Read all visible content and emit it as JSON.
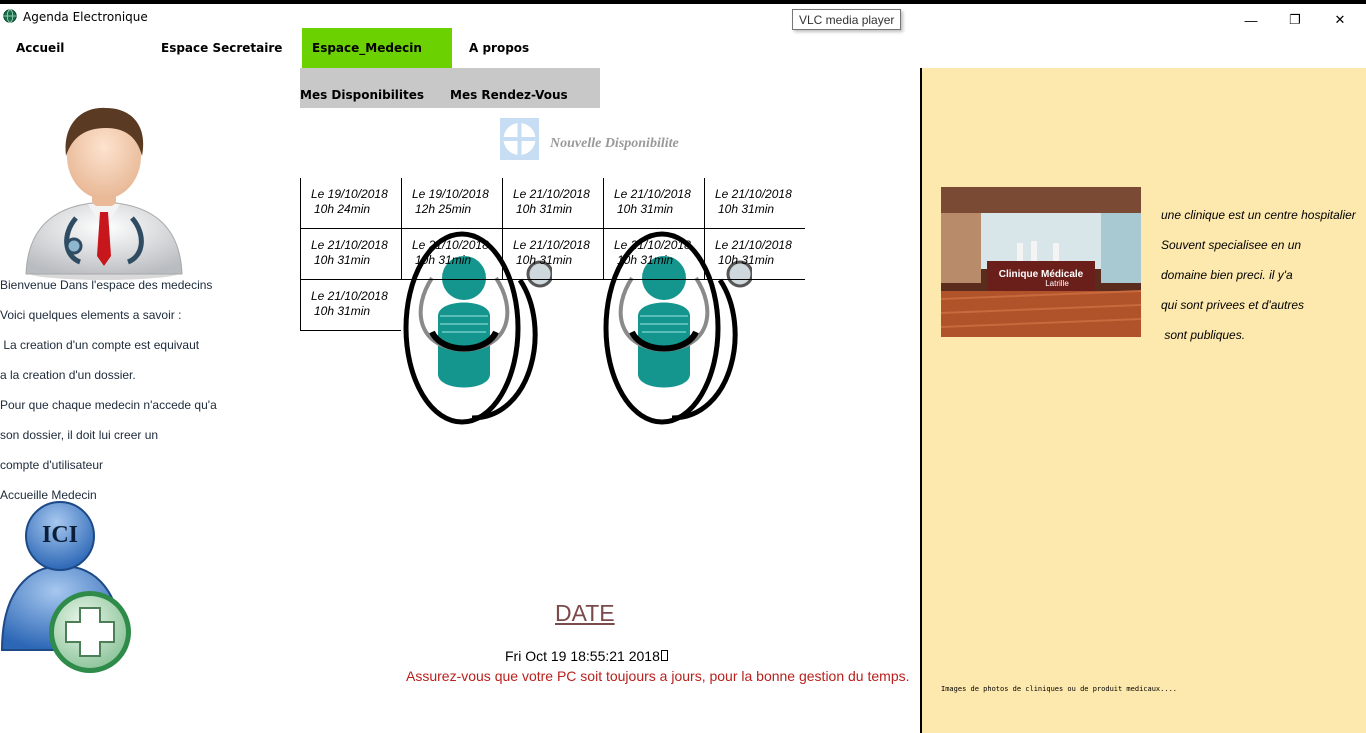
{
  "window": {
    "title": "Agenda Electronique",
    "tooltip": "VLC media player",
    "minimize": "—",
    "maximize": "❐",
    "close": "✕"
  },
  "menu": {
    "accueil": "Accueil",
    "espace_secretaire": "Espace Secretaire",
    "espace_medecin": "Espace_Medecin",
    "a_propos": "A propos",
    "active_color": "#6bd100"
  },
  "submenu": {
    "mes_disponibilites": "Mes Disponibilites",
    "mes_rendez_vous": "Mes Rendez-Vous"
  },
  "left": {
    "lines": [
      "Bienvenue Dans l'espace des medecins",
      "Voici quelques elements a savoir :",
      " La creation d'un compte est equivaut",
      "a la creation d'un dossier.",
      "Pour que chaque medecin n'accede qu'a",
      "son dossier, il doit lui creer un",
      "compte d'utilisateur",
      "Accueille Medecin"
    ],
    "ici_label": "ICI"
  },
  "center": {
    "new_dispo": "Nouvelle Disponibilite",
    "slots": [
      {
        "date": "Le 19/10/2018",
        "time": "10h 24min"
      },
      {
        "date": "Le 19/10/2018",
        "time": "12h 25min"
      },
      {
        "date": "Le 21/10/2018",
        "time": "10h 31min"
      },
      {
        "date": "Le 21/10/2018",
        "time": "10h 31min"
      },
      {
        "date": "Le 21/10/2018",
        "time": "10h 31min"
      },
      {
        "date": "Le 21/10/2018",
        "time": "10h 31min"
      },
      {
        "date": "Le 21/10/2018",
        "time": "10h 31min"
      },
      {
        "date": "Le 21/10/2018",
        "time": "10h 31min"
      },
      {
        "date": "Le 21/10/2018",
        "time": "10h 31min"
      },
      {
        "date": "Le 21/10/2018",
        "time": "10h 31min"
      },
      {
        "date": "Le 21/10/2018",
        "time": "10h 31min"
      }
    ],
    "date_link": "DATE",
    "clock": "Fri Oct 19 18:55:21 2018",
    "warning": "Assurez-vous que votre PC soit toujours a jours, pour la bonne gestion du temps."
  },
  "right": {
    "photo_text_1": "Clinique Médicale",
    "photo_text_2": "Latrille",
    "lines": [
      "une clinique est un centre hospitalier",
      "Souvent specialisee en un",
      "domaine bien preci. il y'a",
      "qui sont privees et d'autres",
      " sont publiques."
    ],
    "caption": "Images de photos de cliniques ou de produit medicaux....",
    "background": "#fde9ad"
  }
}
